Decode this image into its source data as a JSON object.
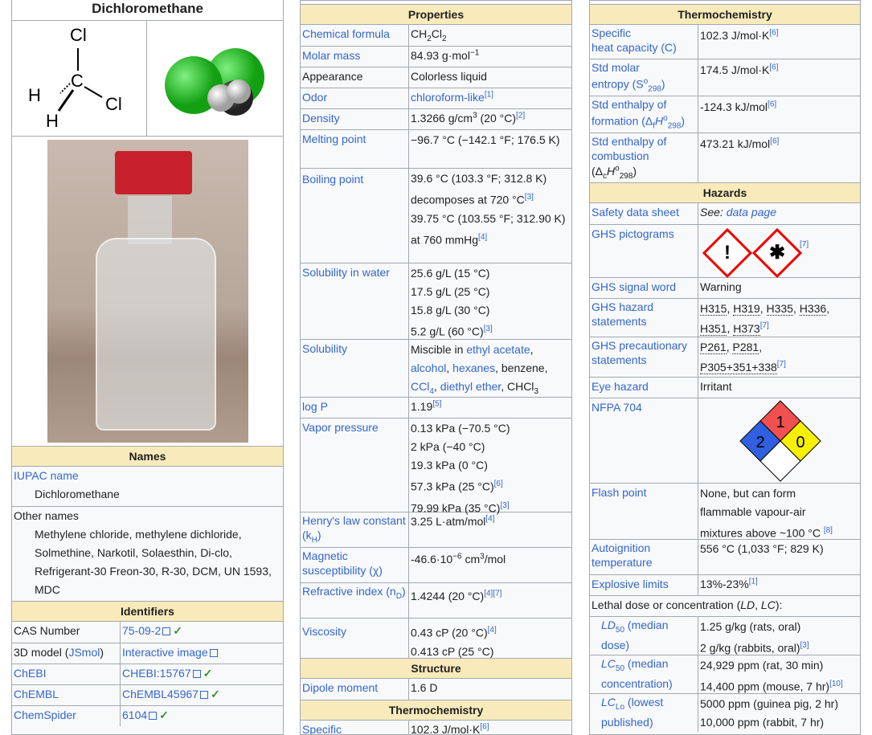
{
  "col1": {
    "title": "Dichloromethane",
    "mol2d": {
      "cl_top": "Cl",
      "cl_right": "Cl",
      "h_left": "H",
      "h_bottom": "H",
      "c": "C"
    },
    "names_header": "Names",
    "iupac_label": "IUPAC name",
    "iupac_value": "Dichloromethane",
    "other_label": "Other names",
    "other_value": "Methylene chloride, methylene dichloride, Solmethine, Narkotil, Solaesthin, Di-clo, Refrigerant-30 Freon-30, R-30, DCM, UN 1593, MDC",
    "ident_header": "Identifiers",
    "idents": [
      {
        "label": "CAS Number",
        "value": "75-09-2"
      },
      {
        "label": "3D model (JSmol)",
        "value": "Interactive image"
      },
      {
        "label": "ChEBI",
        "value": "CHEBI:15767"
      },
      {
        "label": "ChEMBL",
        "value": "ChEMBL45967"
      },
      {
        "label": "ChemSpider",
        "value": "6104"
      }
    ],
    "colors": {
      "bottle_cap": "#c8212b",
      "cl_atom": "#22cc22",
      "c_atom": "#333333",
      "h_atom": "#f0f0f0"
    }
  },
  "col2": {
    "props_header": "Properties",
    "rows": {
      "formula": {
        "label": "Chemical formula",
        "v": "CH",
        "s1": "2",
        "v2": "Cl",
        "s2": "2"
      },
      "molar": {
        "label": "Molar mass",
        "v": "84.93 g·mol",
        "sup": "−1"
      },
      "appearance": {
        "label": "Appearance",
        "v": "Colorless liquid"
      },
      "odor": {
        "label": "Odor",
        "v": "chloroform-like",
        "ref": "[1]"
      },
      "density": {
        "label": "Density",
        "v": "1.3266 g/cm",
        "sup": "3",
        "v2": " (20 °C)",
        "ref": "[2]"
      },
      "melting": {
        "label": "Melting point",
        "v": "−96.7 °C (−142.1 °F; 176.5 K)"
      },
      "boiling": {
        "label": "Boiling point",
        "l1": "39.6 °C (103.3 °F; 312.8 K)",
        "l2": "decomposes at 720 °C",
        "r2": "[3]",
        "l3": "39.75 °C (103.55 °F; 312.90 K)",
        "l4": "at 760 mmHg",
        "r4": "[4]"
      },
      "solw": {
        "label": "Solubility in water",
        "l1": "25.6 g/L (15 °C)",
        "l2": "17.5 g/L (25 °C)",
        "l3": "15.8 g/L (30 °C)",
        "l4": "5.2 g/L (60 °C)",
        "r4": "[3]"
      },
      "sol": {
        "label": "Solubility",
        "a": "Miscible in ",
        "b": "ethyl acetate",
        "c": ",",
        "d": "alcohol",
        "e": ", ",
        "f": "hexanes",
        "g": ", benzene,",
        "h": "CCl",
        "hs": "4",
        "i": ", ",
        "j": "diethyl ether",
        "k": ", CHCl",
        "ks": "3"
      },
      "logp": {
        "label": "log P",
        "v": "1.19",
        "ref": "[5]"
      },
      "vapor": {
        "label": "Vapor pressure",
        "l1": "0.13 kPa (−70.5 °C)",
        "l2": "2 kPa (−40 °C)",
        "l3": "19.3 kPa (0 °C)",
        "l4": "57.3 kPa (25 °C)",
        "r4": "[6]",
        "l5": "79.99 kPa (35 °C)",
        "r5": "[3]"
      },
      "henry": {
        "label": "Henry's law constant (k",
        "ls": "H",
        "le": ")",
        "v": "3.25 L·atm/mol",
        "ref": "[4]"
      },
      "magnetic": {
        "label": "Magnetic susceptibility (χ)",
        "v": "-46.6·10",
        "sup": "−6",
        "v2": " cm",
        "sup2": "3",
        "v3": "/mol"
      },
      "refr": {
        "label": "Refractive index (n",
        "ls": "D",
        "le": ")",
        "v": "1.4244 (20 °C)",
        "ref": "[4][7]"
      },
      "visc": {
        "label": "Viscosity",
        "l1": "0.43 cP (20 °C)",
        "r1": "[4]",
        "l2": "0.413 cP (25 °C)"
      }
    },
    "struct_header": "Structure",
    "dipole": {
      "label": "Dipole moment",
      "v": "1.6 D"
    },
    "thermo_header": "Thermochemistry",
    "spec": {
      "label": "Specific",
      "v": "102.3 J/mol·K",
      "ref": "[6]"
    }
  },
  "col3": {
    "thermo_header": "Thermochemistry",
    "heat": {
      "l1": "Specific",
      "l2": "heat capacity (C)",
      "v": "102.3 J/mol·K",
      "ref": "[6]"
    },
    "entropy": {
      "l1": "Std molar",
      "l2": "entropy (S",
      "l2s": "o",
      "l2b": "298",
      "l2e": ")",
      "v": "174.5 J/mol·K",
      "ref": "[6]"
    },
    "enth": {
      "l1": "Std enthalpy of",
      "l2": "formation (Δ",
      "l2f": "f",
      "l2h": "H",
      "l2s": "o",
      "l2b": "298",
      "l2e": ")",
      "v": "-124.3 kJ/mol",
      "ref": "[6]"
    },
    "comb": {
      "l1": "Std enthalpy of",
      "l2": "combustion",
      "l3": "(Δ",
      "l3c": "c",
      "l3h": "H",
      "l3s": "o",
      "l3b": "298",
      "l3e": ")",
      "v": "473.21 kJ/mol",
      "ref": "[6]"
    },
    "haz_header": "Hazards",
    "sds": {
      "label": "Safety data sheet",
      "a": "See: ",
      "b": "data page"
    },
    "picto": {
      "label": "GHS pictograms",
      "ref": "[7]",
      "p1": "!",
      "p2": "✱"
    },
    "signal": {
      "label": "GHS signal word",
      "v": "Warning"
    },
    "hazard": {
      "label": "GHS hazard statements",
      "c1": "H315",
      "c2": "H319",
      "c3": "H335",
      "c4": "H336",
      "c5": "H351",
      "c6": "H373",
      "ref": "[7]"
    },
    "precaut": {
      "label": "GHS precautionary statements",
      "c1": "P261",
      "c2": "P281",
      "c3": "P305+351+338",
      "ref": "[7]"
    },
    "eye": {
      "label": "Eye hazard",
      "v": "Irritant"
    },
    "nfpa": {
      "label": "NFPA 704",
      "red": "1",
      "blue": "2",
      "yellow": "0",
      "white": ""
    },
    "flash": {
      "label": "Flash point",
      "l1": "None, but can form",
      "l2": "flammable vapour-air",
      "l3": "mixtures above ~100 °C",
      "ref": "[8]"
    },
    "auto": {
      "label": "Autoignition temperature",
      "v": "556 °C (1,033 °F; 829 K)"
    },
    "explo": {
      "label": "Explosive limits",
      "v": "13%-23%",
      "ref": "[1]"
    },
    "lethal": {
      "label": "Lethal dose or concentration (",
      "l1": "LD",
      "l2": ", ",
      "l3": "LC",
      "l4": "):"
    },
    "ld50": {
      "a": "LD",
      "s": "50",
      "b": " (median",
      "c": "dose)",
      "v1": "1.25 g/kg (rats, oral)",
      "v2": "2 g/kg (rabbits, oral)",
      "ref": "[3]"
    },
    "lc50": {
      "a": "LC",
      "s": "50",
      "b": " (median",
      "c": "concentration)",
      "v1": "24,929 ppm (rat, 30 min)",
      "v2": "14,400 ppm (mouse, 7 hr)",
      "ref": "[10]"
    },
    "lclo": {
      "a": "LC",
      "s": "Lo",
      "b": " (lowest",
      "c": "published)",
      "v1": "5000 ppm (guinea pig, 2 hr)",
      "v2": "10,000 ppm (rabbit, 7 hr)"
    }
  }
}
